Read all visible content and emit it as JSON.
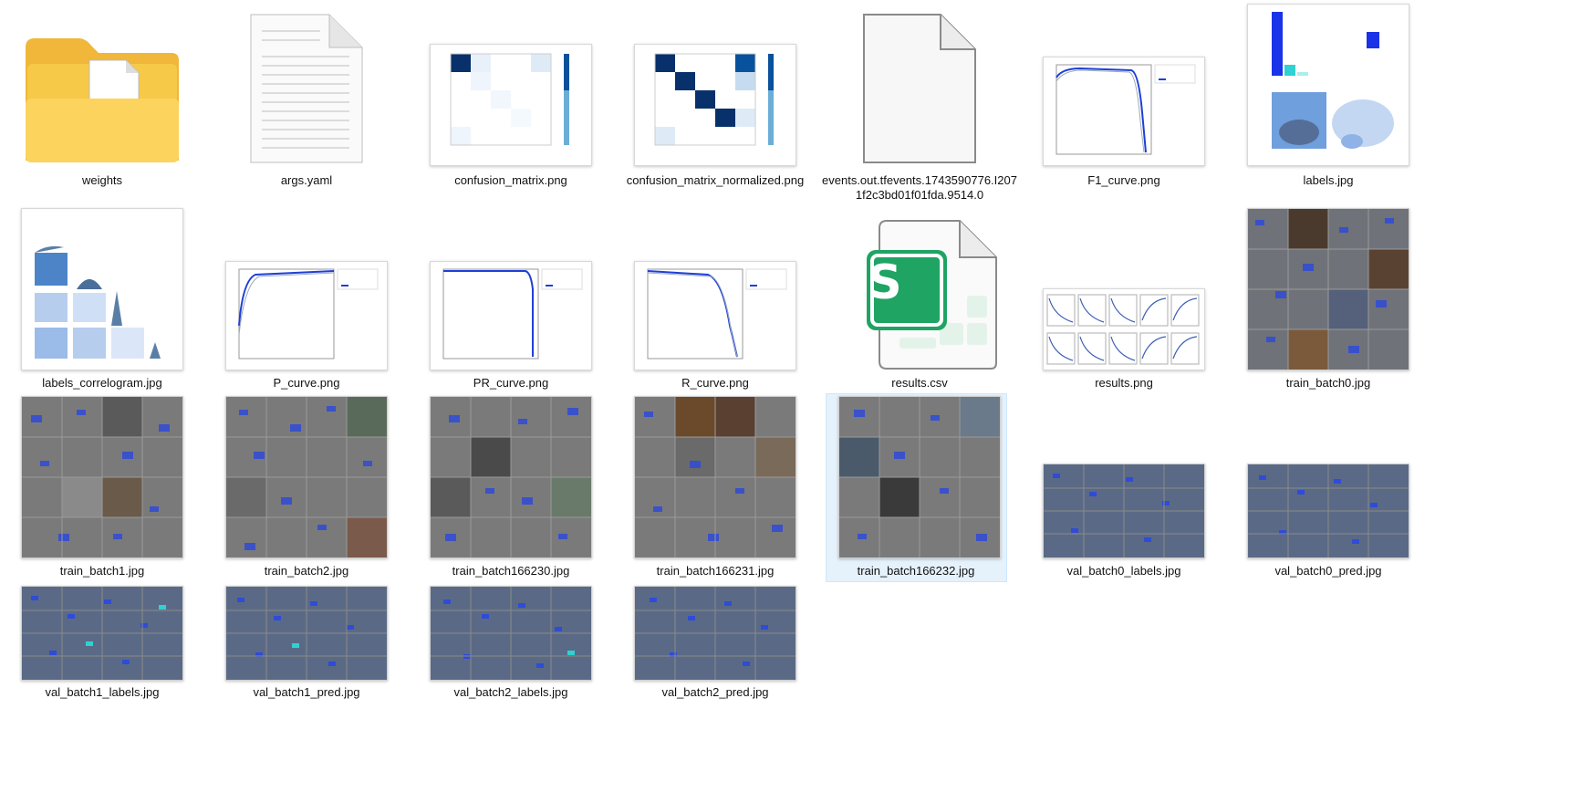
{
  "files": [
    {
      "name": "weights",
      "icon": "folder-icon"
    },
    {
      "name": "args.yaml",
      "icon": "text-document-icon"
    },
    {
      "name": "confusion_matrix.png",
      "icon": "confusion-matrix-thumbnail"
    },
    {
      "name": "confusion_matrix_normalized.png",
      "icon": "confusion-matrix-normalized-thumbnail"
    },
    {
      "name": "events.out.tfevents.1743590776.I2071f2c3bd01f01fda.9514.0",
      "icon": "blank-file-icon"
    },
    {
      "name": "F1_curve.png",
      "icon": "f1-curve-thumbnail"
    },
    {
      "name": "labels.jpg",
      "icon": "labels-thumbnail"
    },
    {
      "name": "labels_correlogram.jpg",
      "icon": "labels-correlogram-thumbnail"
    },
    {
      "name": "P_curve.png",
      "icon": "p-curve-thumbnail"
    },
    {
      "name": "PR_curve.png",
      "icon": "pr-curve-thumbnail"
    },
    {
      "name": "R_curve.png",
      "icon": "r-curve-thumbnail"
    },
    {
      "name": "results.csv",
      "icon": "spreadsheet-icon",
      "icon_letter": "S"
    },
    {
      "name": "results.png",
      "icon": "results-thumbnail"
    },
    {
      "name": "train_batch0.jpg",
      "icon": "image-thumbnail"
    },
    {
      "name": "train_batch1.jpg",
      "icon": "image-thumbnail"
    },
    {
      "name": "train_batch2.jpg",
      "icon": "image-thumbnail"
    },
    {
      "name": "train_batch166230.jpg",
      "icon": "image-thumbnail"
    },
    {
      "name": "train_batch166231.jpg",
      "icon": "image-thumbnail"
    },
    {
      "name": "train_batch166232.jpg",
      "icon": "image-thumbnail",
      "selected": true
    },
    {
      "name": "val_batch0_labels.jpg",
      "icon": "image-thumbnail"
    },
    {
      "name": "val_batch0_pred.jpg",
      "icon": "image-thumbnail"
    },
    {
      "name": "val_batch1_labels.jpg",
      "icon": "image-thumbnail"
    },
    {
      "name": "val_batch1_pred.jpg",
      "icon": "image-thumbnail"
    },
    {
      "name": "val_batch2_labels.jpg",
      "icon": "image-thumbnail"
    },
    {
      "name": "val_batch2_pred.jpg",
      "icon": "image-thumbnail"
    }
  ],
  "colors": {
    "selection": "#e5f1fb",
    "folder": "#f7c948",
    "spreadsheet": "#1fa463",
    "matrix": "#08306b",
    "curve": "#1f3fd6"
  }
}
